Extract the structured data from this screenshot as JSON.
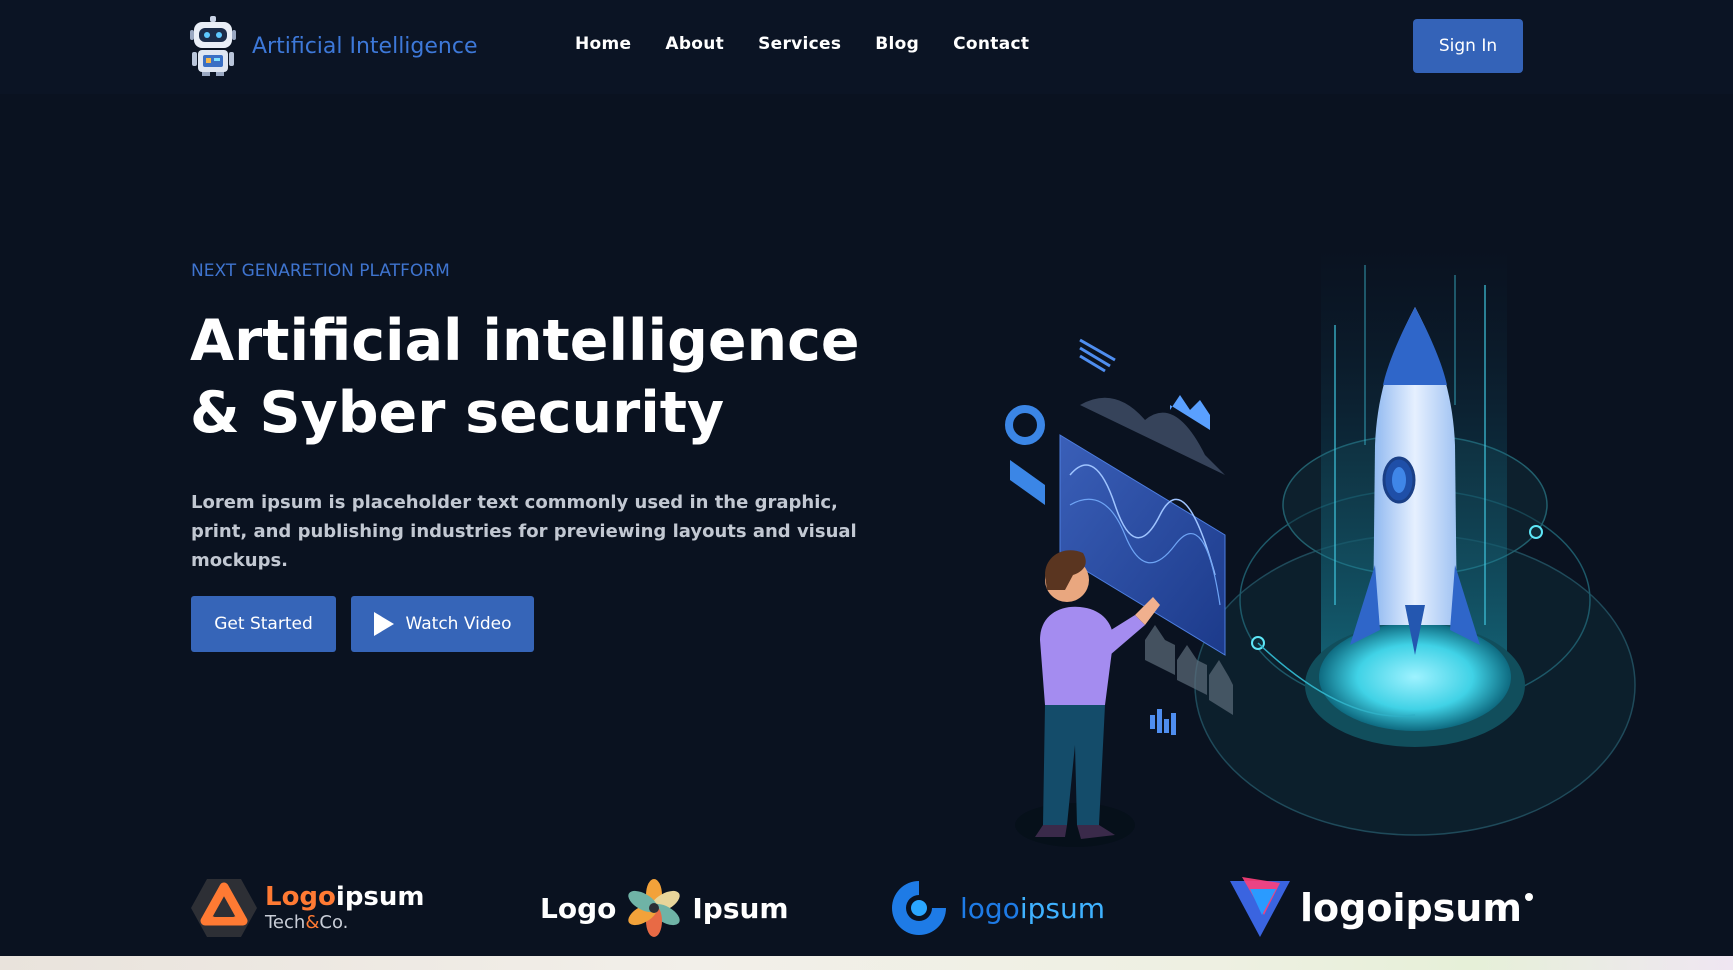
{
  "brand": {
    "name": "Artificial Intelligence",
    "logo_icon": "robot-icon"
  },
  "nav": {
    "items": [
      "Home",
      "About",
      "Services",
      "Blog",
      "Contact"
    ]
  },
  "signin_label": "Sign In",
  "hero": {
    "eyebrow": "NEXT GENARETION PLATFORM",
    "title_line1": "Artificial intelligence",
    "title_line2": "& Syber security",
    "description": "Lorem ipsum is placeholder text commonly used in the graphic, print, and publishing industries for previewing layouts and visual mockups.",
    "cta_primary": "Get Started",
    "cta_secondary": "Watch Video",
    "cta_secondary_icon": "play-icon",
    "illustration": "rocket-launch-illustration"
  },
  "partners": [
    {
      "name": "Logoipsum",
      "prefix": "Logo",
      "suffix": "ipsum",
      "tagline_prefix": "Tech",
      "tagline_amp": "&",
      "tagline_suffix": "Co.",
      "icon": "hexagon-logo-icon"
    },
    {
      "prefix": "Logo",
      "suffix": "Ipsum",
      "icon": "flower-logo-icon"
    },
    {
      "prefix": "logo",
      "suffix": "ipsum",
      "icon": "c-ring-logo-icon"
    },
    {
      "name": "logoipsum",
      "icon": "triangle-logo-icon"
    }
  ],
  "colors": {
    "background": "#0a1220",
    "accent": "#3665b8",
    "brand_text": "#3d78d8",
    "partner_orange": "#ff7a33"
  }
}
